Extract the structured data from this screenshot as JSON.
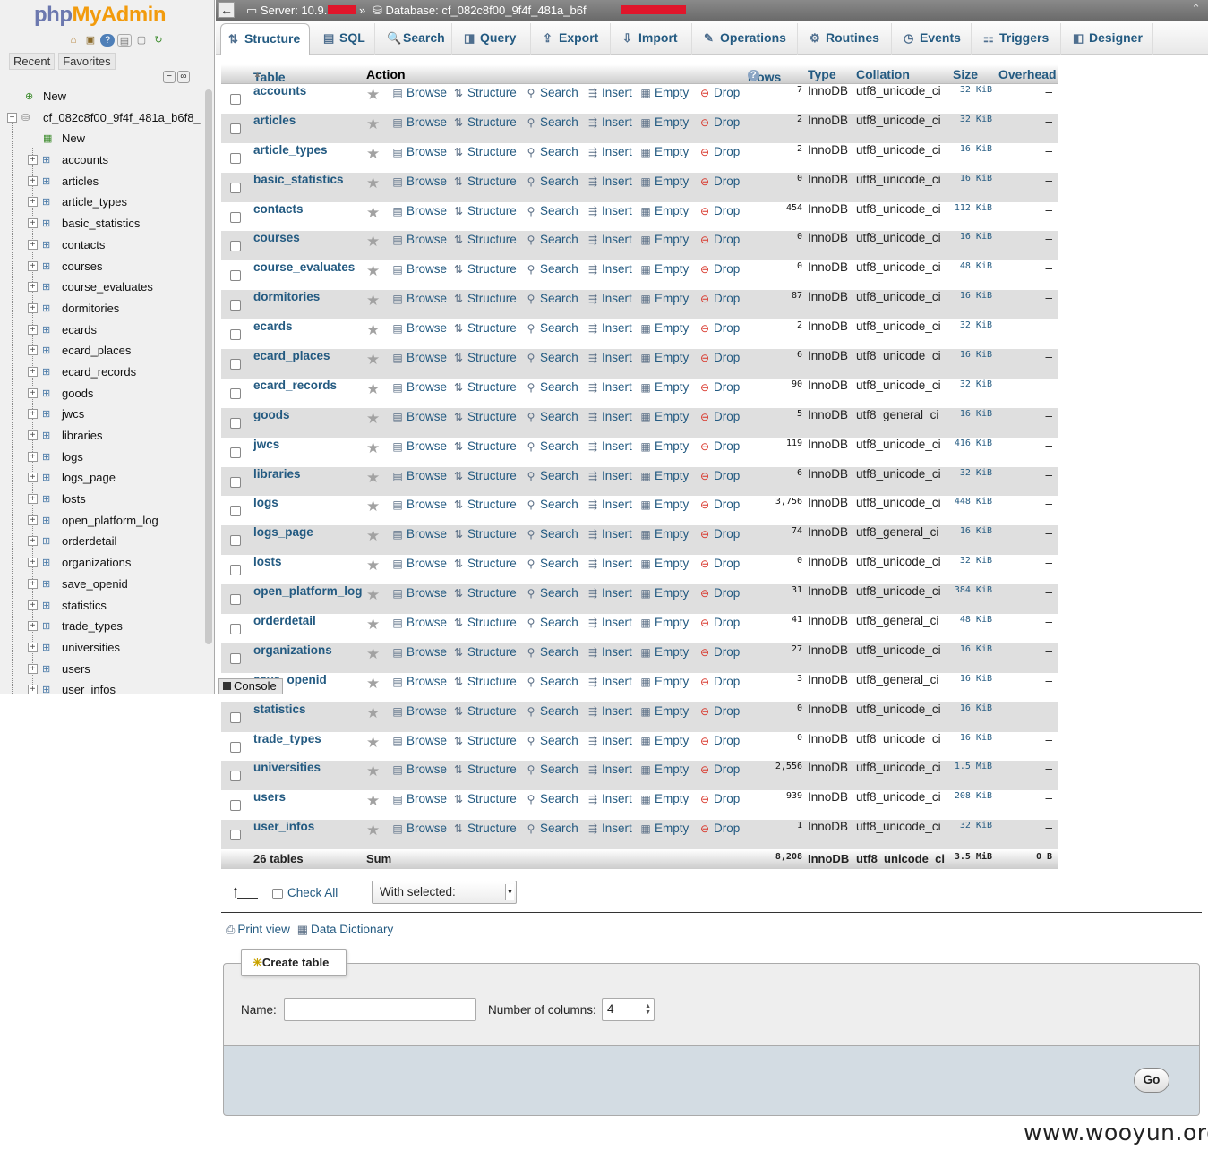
{
  "brand": {
    "php": "php",
    "myadmin": "MyAdmin"
  },
  "nav": {
    "tabs": [
      "Recent",
      "Favorites"
    ],
    "new_label": "New",
    "db_label": "cf_082c8f00_9f4f_481a_b6f8_",
    "db_new_label": "New",
    "tables": [
      "accounts",
      "articles",
      "article_types",
      "basic_statistics",
      "contacts",
      "courses",
      "course_evaluates",
      "dormitories",
      "ecards",
      "ecard_places",
      "ecard_records",
      "goods",
      "jwcs",
      "libraries",
      "logs",
      "logs_page",
      "losts",
      "open_platform_log",
      "orderdetail",
      "organizations",
      "save_openid",
      "statistics",
      "trade_types",
      "universities",
      "users",
      "user_infos"
    ]
  },
  "topbar": {
    "server": "Server: 10.9.1.",
    "sep": "»",
    "database": "Database: cf_082c8f00_9f4f_481a_b6f"
  },
  "menu": {
    "tabs": [
      {
        "label": "Structure",
        "icon": "structure-icon",
        "glyph": "⇅"
      },
      {
        "label": "SQL",
        "icon": "sql-icon",
        "glyph": "▤"
      },
      {
        "label": "Search",
        "icon": "search-icon",
        "glyph": "🔍"
      },
      {
        "label": "Query",
        "icon": "query-icon",
        "glyph": "◨"
      },
      {
        "label": "Export",
        "icon": "export-icon",
        "glyph": "⇪"
      },
      {
        "label": "Import",
        "icon": "import-icon",
        "glyph": "⇩"
      },
      {
        "label": "Operations",
        "icon": "wrench-icon",
        "glyph": "✎"
      },
      {
        "label": "Routines",
        "icon": "routines-icon",
        "glyph": "⚙"
      },
      {
        "label": "Events",
        "icon": "clock-icon",
        "glyph": "◷"
      },
      {
        "label": "Triggers",
        "icon": "triggers-icon",
        "glyph": "⚏"
      },
      {
        "label": "Designer",
        "icon": "designer-icon",
        "glyph": "◧"
      }
    ]
  },
  "table": {
    "headers": {
      "table": "Table",
      "action": "Action",
      "rows": "Rows",
      "type": "Type",
      "collation": "Collation",
      "size": "Size",
      "overhead": "Overhead"
    },
    "actions": [
      "Browse",
      "Structure",
      "Search",
      "Insert",
      "Empty",
      "Drop"
    ],
    "rows": [
      {
        "name": "accounts",
        "rows": "7",
        "type": "InnoDB",
        "collation": "utf8_unicode_ci",
        "size": "32 KiB",
        "overhead": "–"
      },
      {
        "name": "articles",
        "rows": "2",
        "type": "InnoDB",
        "collation": "utf8_unicode_ci",
        "size": "32 KiB",
        "overhead": "–"
      },
      {
        "name": "article_types",
        "rows": "2",
        "type": "InnoDB",
        "collation": "utf8_unicode_ci",
        "size": "16 KiB",
        "overhead": "–"
      },
      {
        "name": "basic_statistics",
        "rows": "0",
        "type": "InnoDB",
        "collation": "utf8_unicode_ci",
        "size": "16 KiB",
        "overhead": "–"
      },
      {
        "name": "contacts",
        "rows": "454",
        "type": "InnoDB",
        "collation": "utf8_unicode_ci",
        "size": "112 KiB",
        "overhead": "–"
      },
      {
        "name": "courses",
        "rows": "0",
        "type": "InnoDB",
        "collation": "utf8_unicode_ci",
        "size": "16 KiB",
        "overhead": "–"
      },
      {
        "name": "course_evaluates",
        "rows": "0",
        "type": "InnoDB",
        "collation": "utf8_unicode_ci",
        "size": "48 KiB",
        "overhead": "–"
      },
      {
        "name": "dormitories",
        "rows": "87",
        "type": "InnoDB",
        "collation": "utf8_unicode_ci",
        "size": "16 KiB",
        "overhead": "–"
      },
      {
        "name": "ecards",
        "rows": "2",
        "type": "InnoDB",
        "collation": "utf8_unicode_ci",
        "size": "32 KiB",
        "overhead": "–"
      },
      {
        "name": "ecard_places",
        "rows": "6",
        "type": "InnoDB",
        "collation": "utf8_unicode_ci",
        "size": "16 KiB",
        "overhead": "–"
      },
      {
        "name": "ecard_records",
        "rows": "90",
        "type": "InnoDB",
        "collation": "utf8_unicode_ci",
        "size": "32 KiB",
        "overhead": "–"
      },
      {
        "name": "goods",
        "rows": "5",
        "type": "InnoDB",
        "collation": "utf8_general_ci",
        "size": "16 KiB",
        "overhead": "–"
      },
      {
        "name": "jwcs",
        "rows": "119",
        "type": "InnoDB",
        "collation": "utf8_unicode_ci",
        "size": "416 KiB",
        "overhead": "–"
      },
      {
        "name": "libraries",
        "rows": "6",
        "type": "InnoDB",
        "collation": "utf8_unicode_ci",
        "size": "32 KiB",
        "overhead": "–"
      },
      {
        "name": "logs",
        "rows": "3,756",
        "type": "InnoDB",
        "collation": "utf8_unicode_ci",
        "size": "448 KiB",
        "overhead": "–"
      },
      {
        "name": "logs_page",
        "rows": "74",
        "type": "InnoDB",
        "collation": "utf8_general_ci",
        "size": "16 KiB",
        "overhead": "–"
      },
      {
        "name": "losts",
        "rows": "0",
        "type": "InnoDB",
        "collation": "utf8_unicode_ci",
        "size": "32 KiB",
        "overhead": "–"
      },
      {
        "name": "open_platform_log",
        "rows": "31",
        "type": "InnoDB",
        "collation": "utf8_unicode_ci",
        "size": "384 KiB",
        "overhead": "–"
      },
      {
        "name": "orderdetail",
        "rows": "41",
        "type": "InnoDB",
        "collation": "utf8_general_ci",
        "size": "48 KiB",
        "overhead": "–"
      },
      {
        "name": "organizations",
        "rows": "27",
        "type": "InnoDB",
        "collation": "utf8_unicode_ci",
        "size": "16 KiB",
        "overhead": "–"
      },
      {
        "name": "save_openid",
        "rows": "3",
        "type": "InnoDB",
        "collation": "utf8_general_ci",
        "size": "16 KiB",
        "overhead": "–"
      },
      {
        "name": "statistics",
        "rows": "0",
        "type": "InnoDB",
        "collation": "utf8_unicode_ci",
        "size": "16 KiB",
        "overhead": "–"
      },
      {
        "name": "trade_types",
        "rows": "0",
        "type": "InnoDB",
        "collation": "utf8_unicode_ci",
        "size": "16 KiB",
        "overhead": "–"
      },
      {
        "name": "universities",
        "rows": "2,556",
        "type": "InnoDB",
        "collation": "utf8_unicode_ci",
        "size": "1.5 MiB",
        "overhead": "–"
      },
      {
        "name": "users",
        "rows": "939",
        "type": "InnoDB",
        "collation": "utf8_unicode_ci",
        "size": "208 KiB",
        "overhead": "–"
      },
      {
        "name": "user_infos",
        "rows": "1",
        "type": "InnoDB",
        "collation": "utf8_unicode_ci",
        "size": "32 KiB",
        "overhead": "–"
      }
    ],
    "summary": {
      "count": "26 tables",
      "label": "Sum",
      "rows": "8,208",
      "type": "InnoDB",
      "collation": "utf8_unicode_ci",
      "size": "3.5 MiB",
      "overhead": "0 B"
    }
  },
  "console_label": "Console",
  "footer": {
    "check_all": "Check All",
    "with_selected": "With selected:",
    "print_view": "Print view",
    "data_dictionary": "Data Dictionary"
  },
  "create_table": {
    "legend": "Create table",
    "name_label": "Name:",
    "name_value": "",
    "columns_label": "Number of columns:",
    "columns_value": "4",
    "go": "Go"
  },
  "watermark": "www.wooyun.org",
  "colors": {
    "link": "#235a81",
    "brand_php": "#6c78af",
    "brand_myadmin": "#f29b0d",
    "row_even": "#dfdfdf",
    "redaction": "#e0162b"
  }
}
